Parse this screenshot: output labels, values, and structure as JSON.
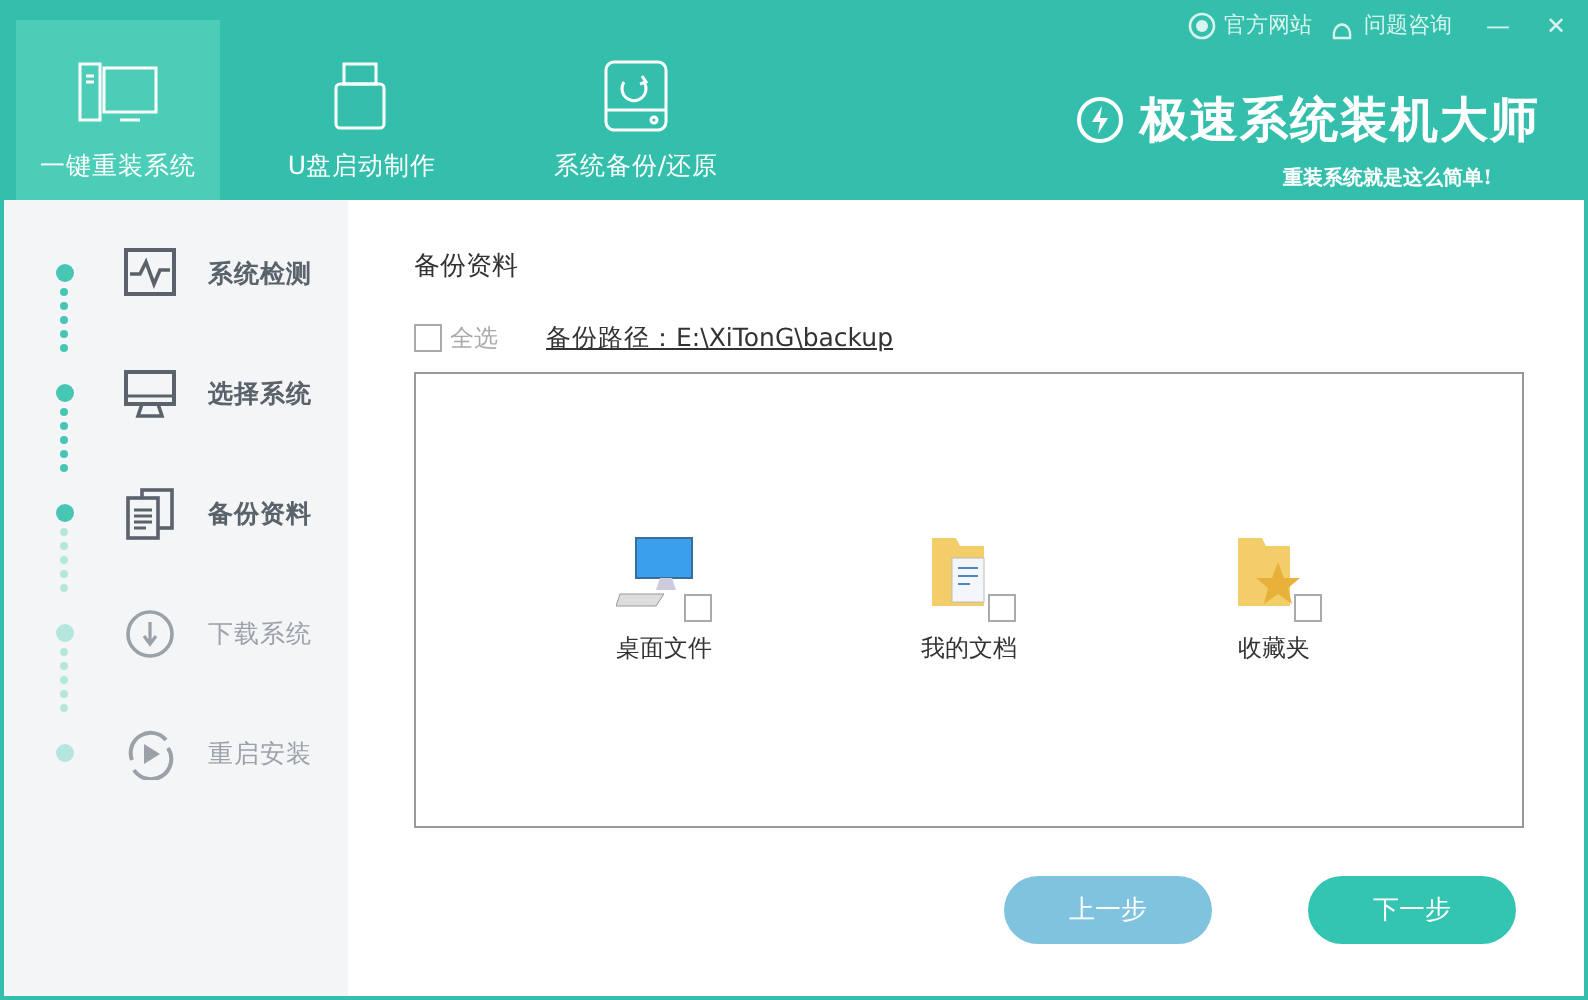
{
  "top_links": [
    {
      "kind": "globe",
      "label": "官方网站"
    },
    {
      "kind": "chat",
      "label": "问题咨询"
    }
  ],
  "window_controls": [
    "—",
    "✕"
  ],
  "tabs": [
    {
      "kind": "pc",
      "label": "一键重装系统",
      "selected": true
    },
    {
      "kind": "usb",
      "label": "U盘启动制作",
      "selected": false
    },
    {
      "kind": "backup",
      "label": "系统备份/还原",
      "selected": false
    }
  ],
  "brand": {
    "title": "极速系统装机大师",
    "slogan": "重装系统就是这么简单!"
  },
  "steps": [
    {
      "kind": "check",
      "label": "系统检测",
      "done": true
    },
    {
      "kind": "monitor",
      "label": "选择系统",
      "done": true
    },
    {
      "kind": "docs",
      "label": "备份资料",
      "done": true
    },
    {
      "kind": "download",
      "label": "下载系统",
      "done": false
    },
    {
      "kind": "restart",
      "label": "重启安装",
      "done": false
    }
  ],
  "section_title": "备份资料",
  "select_all": {
    "label": "全选",
    "checked": false
  },
  "backup_path": "备份路径：E:\\XiTonG\\backup",
  "items": [
    {
      "kind": "desktop",
      "label": "桌面文件",
      "checked": false
    },
    {
      "kind": "documents",
      "label": "我的文档",
      "checked": false
    },
    {
      "kind": "favorites",
      "label": "收藏夹",
      "checked": false
    }
  ],
  "buttons": [
    {
      "kind": "prev",
      "label": "上一步"
    },
    {
      "kind": "next",
      "label": "下一步"
    }
  ]
}
